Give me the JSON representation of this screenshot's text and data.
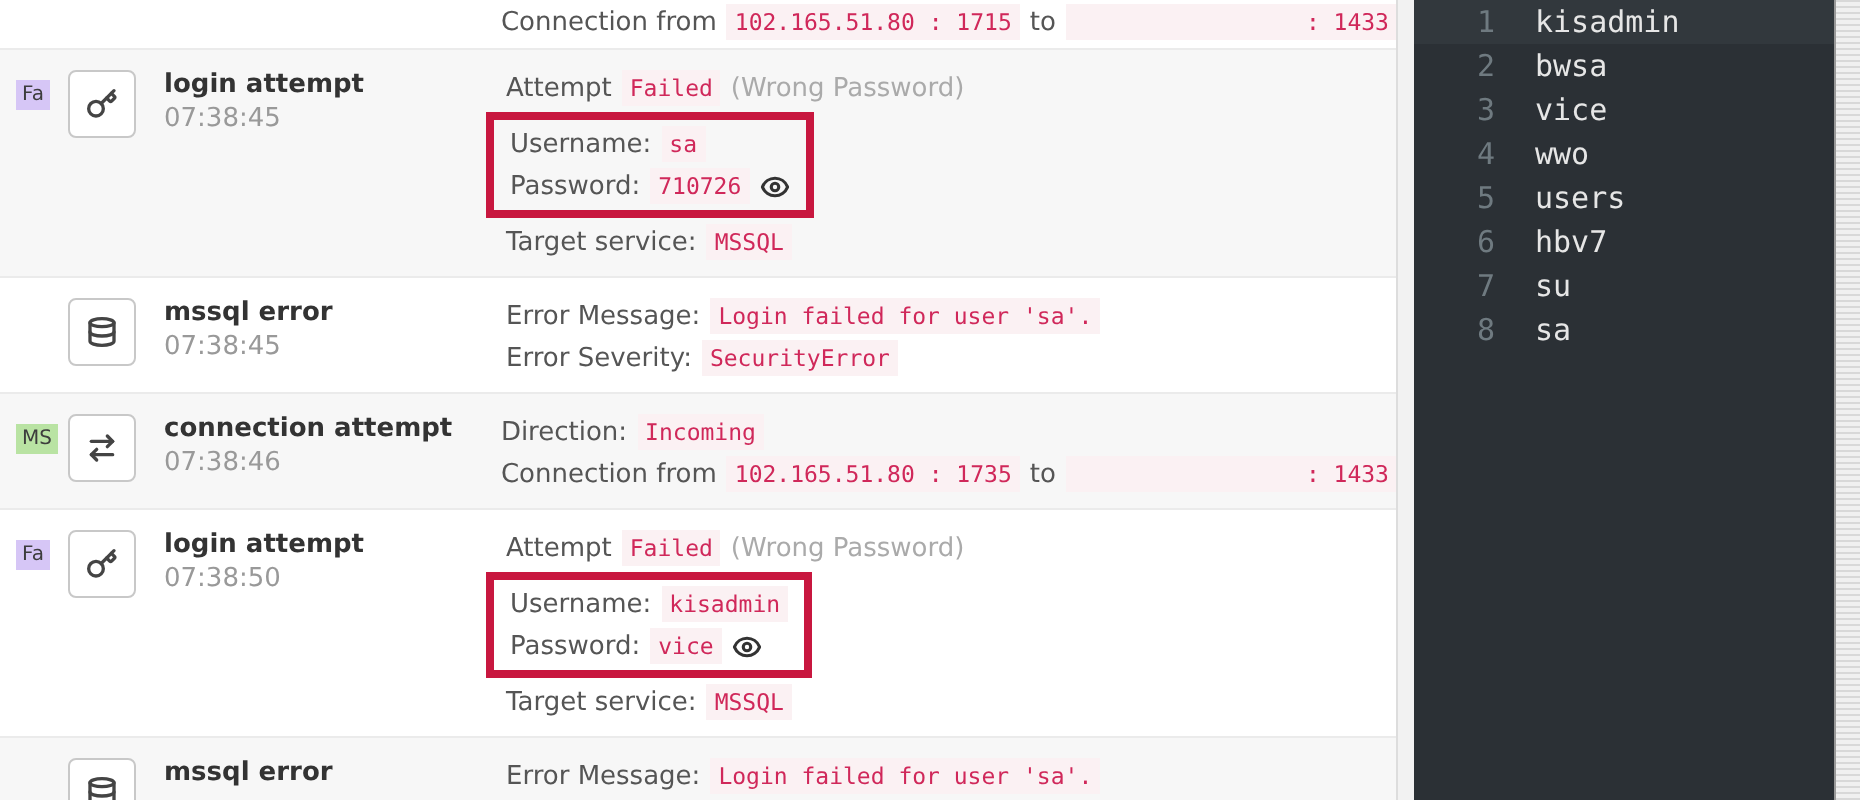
{
  "events": [
    {
      "kind": "connection",
      "lines": [
        {
          "highlighted": false,
          "parts": [
            {
              "kind": "label",
              "text": "Connection from"
            },
            {
              "kind": "code",
              "text": "102.165.51.80 : 1715"
            },
            {
              "kind": "label",
              "text": "to"
            },
            {
              "kind": "redacted",
              "text": ": 1433"
            }
          ]
        }
      ]
    },
    {
      "kind": "login",
      "title": "login attempt",
      "time": "07:38:45",
      "badge": {
        "text": "Fa",
        "color": "#d6c6f6"
      },
      "lines": [
        {
          "highlighted": false,
          "parts": [
            {
              "kind": "label",
              "text": "Attempt"
            },
            {
              "kind": "code",
              "text": "Failed"
            },
            {
              "kind": "muted",
              "text": "(Wrong Password)"
            }
          ]
        },
        {
          "highlighted": true,
          "parts": [
            {
              "kind": "label",
              "text": "Username:"
            },
            {
              "kind": "code",
              "text": "sa"
            }
          ]
        },
        {
          "highlighted": true,
          "reveal": true,
          "parts": [
            {
              "kind": "label",
              "text": "Password:"
            },
            {
              "kind": "code",
              "text": "710726"
            }
          ]
        },
        {
          "highlighted": false,
          "parts": [
            {
              "kind": "label",
              "text": "Target service:"
            },
            {
              "kind": "code",
              "text": "MSSQL"
            }
          ]
        }
      ]
    },
    {
      "kind": "error",
      "title": "mssql error",
      "time": "07:38:45",
      "lines": [
        {
          "highlighted": false,
          "parts": [
            {
              "kind": "label",
              "text": "Error Message:"
            },
            {
              "kind": "code",
              "text": "Login failed for user 'sa'."
            }
          ]
        },
        {
          "highlighted": false,
          "parts": [
            {
              "kind": "label",
              "text": "Error Severity:"
            },
            {
              "kind": "code",
              "text": "SecurityError"
            }
          ]
        }
      ]
    },
    {
      "kind": "connection",
      "title": "connection attempt",
      "time": "07:38:46",
      "badge": {
        "text": "MS",
        "color": "#b9e3a3"
      },
      "lines": [
        {
          "highlighted": false,
          "parts": [
            {
              "kind": "label",
              "text": "Direction:"
            },
            {
              "kind": "code",
              "text": "Incoming"
            }
          ]
        },
        {
          "highlighted": false,
          "parts": [
            {
              "kind": "label",
              "text": "Connection from"
            },
            {
              "kind": "code",
              "text": "102.165.51.80 : 1735"
            },
            {
              "kind": "label",
              "text": "to"
            },
            {
              "kind": "redacted",
              "text": ": 1433"
            }
          ]
        }
      ]
    },
    {
      "kind": "login",
      "title": "login attempt",
      "time": "07:38:50",
      "badge": {
        "text": "Fa",
        "color": "#d6c6f6"
      },
      "lines": [
        {
          "highlighted": false,
          "parts": [
            {
              "kind": "label",
              "text": "Attempt"
            },
            {
              "kind": "code",
              "text": "Failed"
            },
            {
              "kind": "muted",
              "text": "(Wrong Password)"
            }
          ]
        },
        {
          "highlighted": true,
          "parts": [
            {
              "kind": "label",
              "text": "Username:"
            },
            {
              "kind": "code",
              "text": "kisadmin"
            }
          ]
        },
        {
          "highlighted": true,
          "reveal": true,
          "parts": [
            {
              "kind": "label",
              "text": "Password:"
            },
            {
              "kind": "code",
              "text": "vice"
            }
          ]
        },
        {
          "highlighted": false,
          "parts": [
            {
              "kind": "label",
              "text": "Target service:"
            },
            {
              "kind": "code",
              "text": "MSSQL"
            }
          ]
        }
      ]
    },
    {
      "kind": "error",
      "title": "mssql error",
      "lines": [
        {
          "highlighted": false,
          "parts": [
            {
              "kind": "label",
              "text": "Error Message:"
            },
            {
              "kind": "code",
              "text": "Login failed for user 'sa'."
            }
          ]
        }
      ]
    }
  ],
  "editor": {
    "lines": [
      {
        "number": "1",
        "text": "kisadmin"
      },
      {
        "number": "2",
        "text": "bwsa"
      },
      {
        "number": "3",
        "text": "vice"
      },
      {
        "number": "4",
        "text": "wwo"
      },
      {
        "number": "5",
        "text": "users"
      },
      {
        "number": "6",
        "text": "hbv7"
      },
      {
        "number": "7",
        "text": "su"
      },
      {
        "number": "8",
        "text": "sa"
      }
    ]
  }
}
